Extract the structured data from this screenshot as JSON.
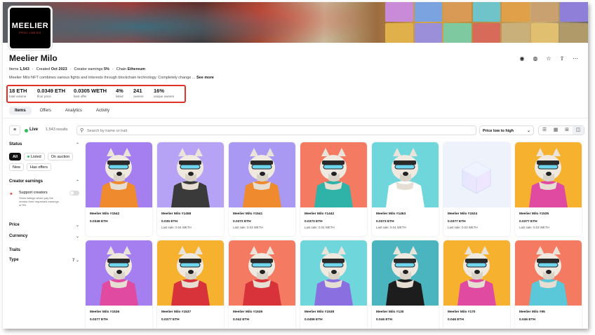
{
  "collection": {
    "logo_title": "MEELIER",
    "logo_sub": "PROJ LAB ED",
    "name": "Meelier Milo",
    "meta": [
      {
        "label": "Items",
        "value": "1,543"
      },
      {
        "label": "Created",
        "value": "Oct 2023"
      },
      {
        "label": "Creator earnings",
        "value": "5%"
      },
      {
        "label": "Chain",
        "value": "Ethereum"
      }
    ],
    "description": "Meelier Milo NFT combines various fights and interests through blockchain technology. Completely change ...",
    "see_more": "See more"
  },
  "header_icons": [
    "globe-icon",
    "discord-icon",
    "star-icon",
    "share-icon",
    "more-icon"
  ],
  "stats": [
    {
      "value": "18 ETH",
      "label": "total volume"
    },
    {
      "value": "0.0349 ETH",
      "label": "floor price"
    },
    {
      "value": "0.0305 WETH",
      "label": "best offer"
    },
    {
      "value": "4%",
      "label": "listed"
    },
    {
      "value": "241",
      "label": "owners"
    },
    {
      "value": "16%",
      "label": "unique owners"
    }
  ],
  "tabs": [
    "Items",
    "Offers",
    "Analytics",
    "Activity"
  ],
  "toolbar": {
    "live": "Live",
    "results": "1,543 results",
    "search_placeholder": "Search by name or trait",
    "sort": "Price low to high"
  },
  "sidebar": {
    "status": "Status",
    "status_chips": [
      "All",
      "Listed",
      "On auction",
      "New",
      "Has offers"
    ],
    "creator_earnings": "Creator earnings",
    "support_title": "Support creators",
    "support_desc": "Show listings which pay the creator their requested earnings of 5%",
    "price": "Price",
    "currency": "Currency",
    "traits": "Traits",
    "type": "Type",
    "type_count": "7"
  },
  "cards": [
    {
      "name": "Meelier Milo #1542",
      "price": "0.0349 ETH",
      "last": "",
      "bg": "#a57ff0"
    },
    {
      "name": "Meelier Milo #1458",
      "price": "0.035 ETH",
      "last": "Last sale: 0.04 WETH",
      "bg": "#b7a3f5"
    },
    {
      "name": "Meelier Milo #1541",
      "price": "0.0372 ETH",
      "last": "Last sale: 0.03 WETH",
      "bg": "#a999f3"
    },
    {
      "name": "Meelier Milo #1442",
      "price": "0.0373 ETH",
      "last": "Last sale: 0.04 WETH",
      "bg": "#f47a62"
    },
    {
      "name": "Meelier Milo #1463",
      "price": "0.0373 ETH",
      "last": "Last sale: 0.04 WETH",
      "bg": "#6fd6dc"
    },
    {
      "name": "Meelier Milo #1524",
      "price": "0.0377 ETH",
      "last": "Last sale: 0.03 WETH",
      "bg": "#eef2fb"
    },
    {
      "name": "Meelier Milo #1535",
      "price": "0.0377 ETH",
      "last": "Last sale: 0.03 WETH",
      "bg": "#f6b12e"
    },
    {
      "name": "Meelier Milo #1536",
      "price": "0.0377 ETH",
      "last": "",
      "bg": "#a57ff0"
    },
    {
      "name": "Meelier Milo #1537",
      "price": "0.0377 ETH",
      "last": "",
      "bg": "#f6b12e"
    },
    {
      "name": "Meelier Milo #1539",
      "price": "0.042 ETH",
      "last": "",
      "bg": "#f47a62"
    },
    {
      "name": "Meelier Milo #1538",
      "price": "0.0459 ETH",
      "last": "",
      "bg": "#6fd6dc"
    },
    {
      "name": "Meelier Milo #130",
      "price": "0.046 ETH",
      "last": "",
      "bg": "#4ab4bf"
    },
    {
      "name": "Meelier Milo #170",
      "price": "0.046 ETH",
      "last": "",
      "bg": "#f6b12e"
    },
    {
      "name": "Meelier Milo #95",
      "price": "0.046 ETH",
      "last": "",
      "bg": "#f47a62"
    }
  ],
  "colors": {
    "highlight": "#e0312b",
    "live": "#2ebd59"
  }
}
